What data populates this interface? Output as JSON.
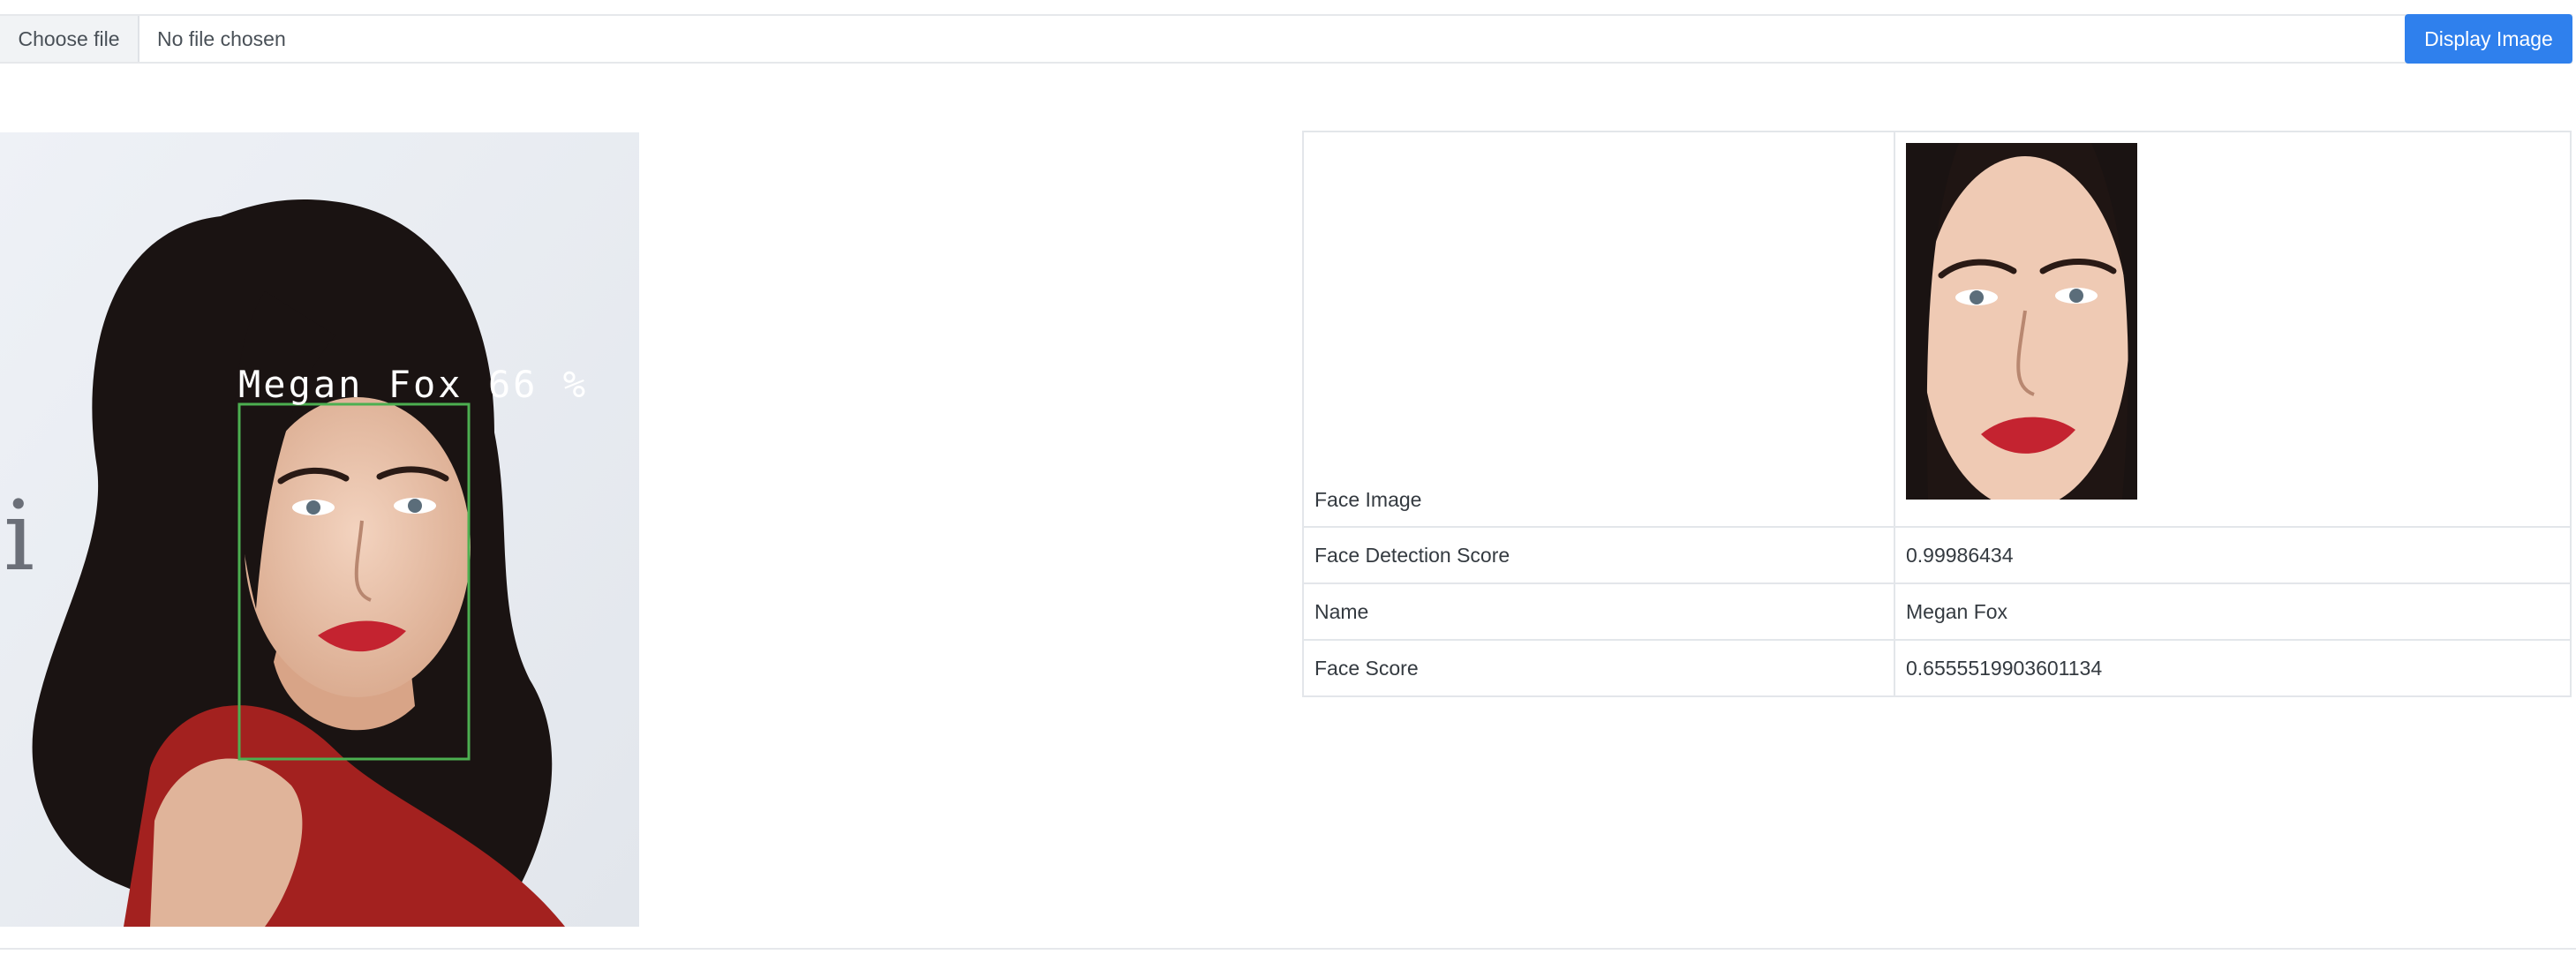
{
  "file_input": {
    "button_label": "Choose file",
    "status_text": "No file chosen"
  },
  "actions": {
    "display_label": "Display Image",
    "accent_color": "#2f80ed"
  },
  "annotated_image": {
    "detection_label": "Megan Fox 66 %",
    "box_color": "#4caf50",
    "background_text": "i"
  },
  "results": {
    "rows": [
      {
        "label": "Face Image",
        "value": ""
      },
      {
        "label": "Face Detection Score",
        "value": "0.99986434"
      },
      {
        "label": "Name",
        "value": "Megan Fox"
      },
      {
        "label": "Face Score",
        "value": "0.6555519903601134"
      }
    ]
  }
}
